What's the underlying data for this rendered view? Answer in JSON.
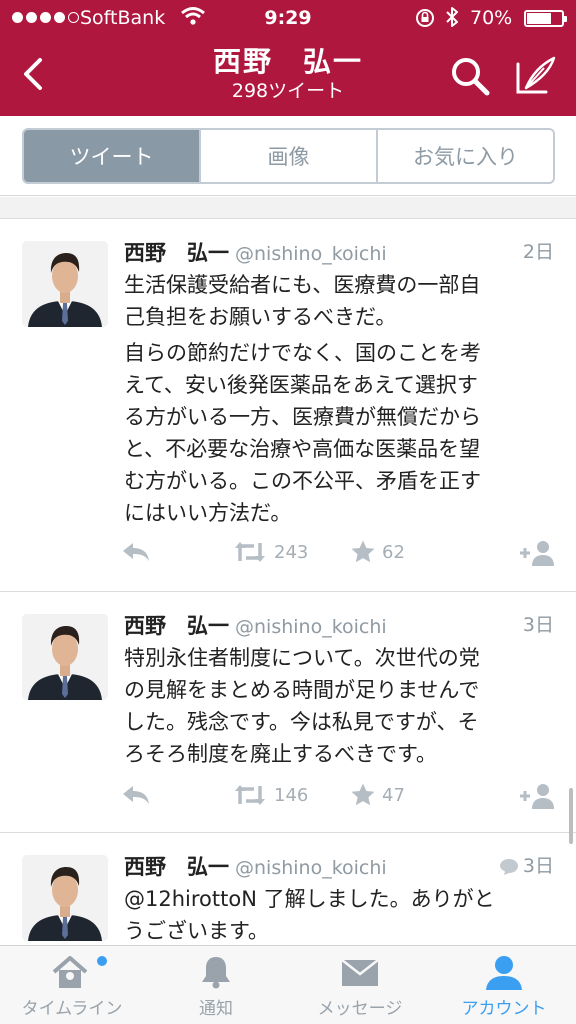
{
  "status": {
    "carrier": "SoftBank",
    "time": "9:29",
    "battery": "70%",
    "battery_level": 0.7
  },
  "nav": {
    "title": "西野　弘一",
    "subtitle": "298ツイート"
  },
  "tabs": {
    "tweets": "ツイート",
    "images": "画像",
    "favorites": "お気に入り",
    "selected": "ツイート"
  },
  "tweets": [
    {
      "name": "西野　弘一",
      "handle": "@nishino_koichi",
      "time": "2日",
      "lines": [
        "生活保護受給者にも、医療費の一部自",
        "己負担をお願いするべきだ。",
        "自らの節約だけでなく、国のことを考",
        "えて、安い後発医薬品をあえて選択す",
        "る方がいる一方、医療費が無償だから",
        "と、不必要な治療や高価な医薬品を望",
        "む方がいる。この不公平、矛盾を正す",
        "にはいい方法だ。"
      ],
      "retweets": "243",
      "favorites": "62"
    },
    {
      "name": "西野　弘一",
      "handle": "@nishino_koichi",
      "time": "3日",
      "lines": [
        "特別永住者制度について。次世代の党",
        "の見解をまとめる時間が足りませんで",
        "した。残念です。今は私見ですが、そ",
        "ろそろ制度を廃止するべきです。"
      ],
      "retweets": "146",
      "favorites": "47"
    },
    {
      "name": "西野　弘一",
      "handle": "@nishino_koichi",
      "time": "3日",
      "lines": [
        "@12hirottoN 了解しました。ありがと",
        "うございます。"
      ]
    }
  ],
  "tabbar": {
    "timeline": "タイムライン",
    "notifications": "通知",
    "messages": "メッセージ",
    "account": "アカウント"
  },
  "colors": {
    "brand": "#b0173f",
    "accent": "#3b9ff1",
    "segment_active": "#8a99a6"
  }
}
